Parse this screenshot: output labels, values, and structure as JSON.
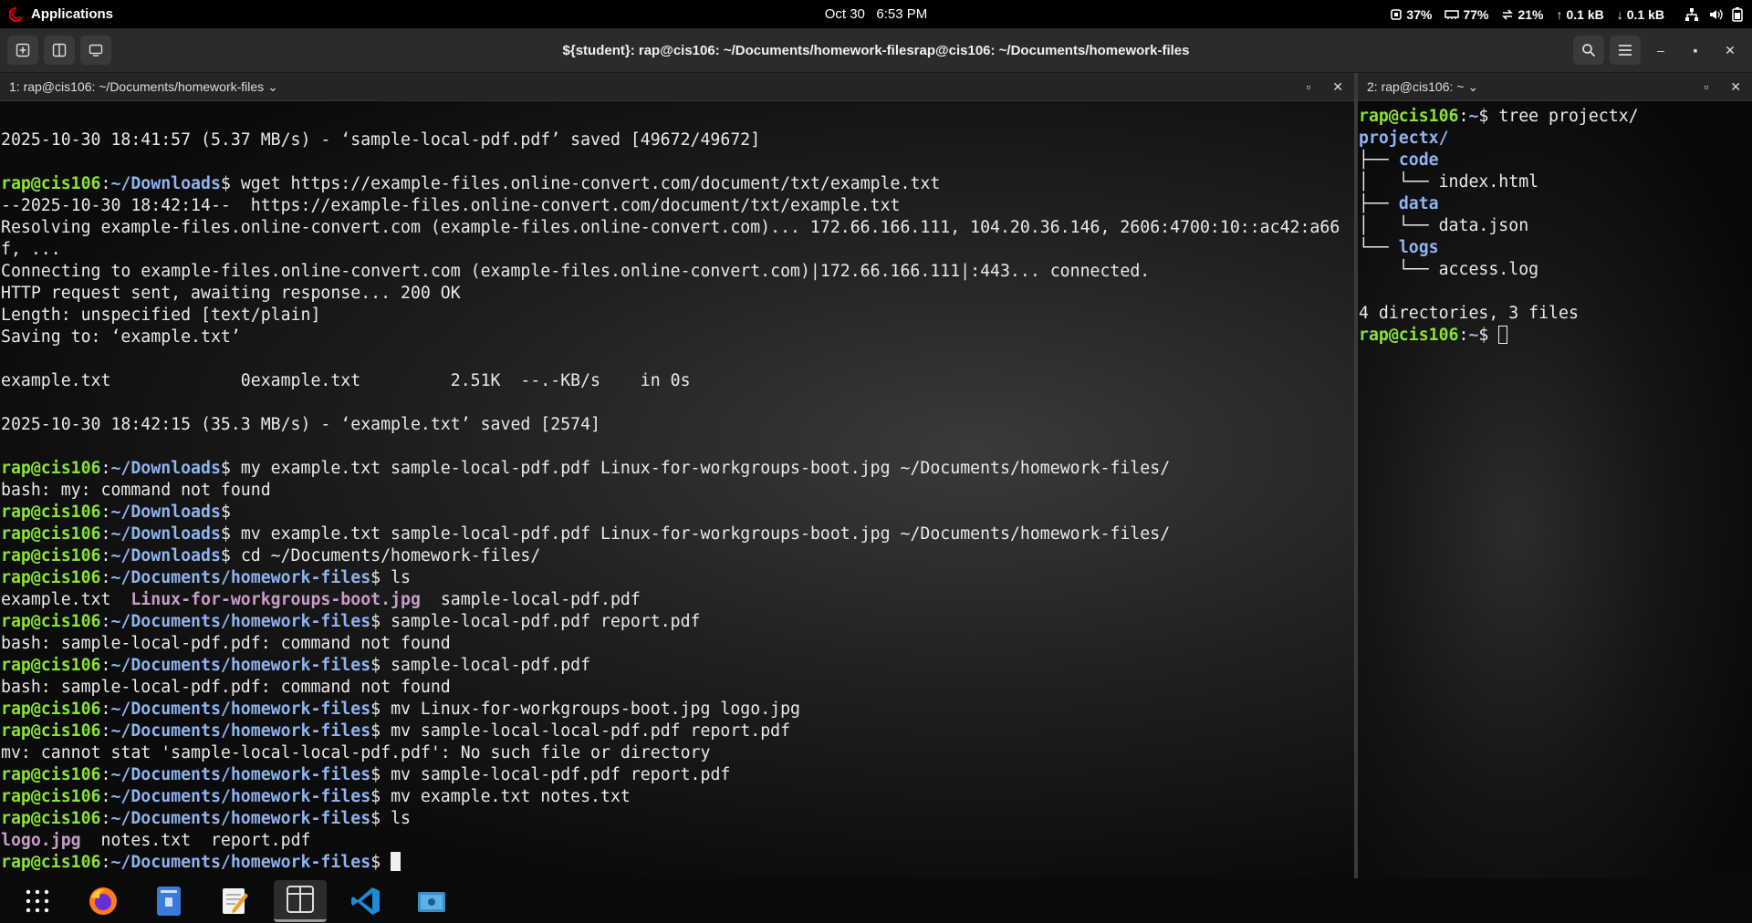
{
  "topbar": {
    "apps_label": "Applications",
    "date": "Oct 30",
    "time": "6:53 PM",
    "cpu": "37%",
    "mem": "77%",
    "swap": "21%",
    "net_up": "0.1 kB",
    "net_down": "0.1 kB"
  },
  "window": {
    "title": "${student}: rap@cis106: ~/Documents/homework-filesrap@cis106: ~/Documents/homework-files"
  },
  "pane_left": {
    "tab_label": "1: rap@cis106: ~/Documents/homework-files",
    "lines": [
      "",
      "2025-10-30 18:41:57 (5.37 MB/s) - ‘sample-local-pdf.pdf’ saved [49672/49672]",
      "",
      {
        "user": "rap@cis106",
        "path": "~/Downloads",
        "cmd": "wget https://example-files.online-convert.com/document/txt/example.txt"
      },
      "--2025-10-30 18:42:14--  https://example-files.online-convert.com/document/txt/example.txt",
      "Resolving example-files.online-convert.com (example-files.online-convert.com)... 172.66.166.111, 104.20.36.146, 2606:4700:10::ac42:a66",
      "f, ...",
      "Connecting to example-files.online-convert.com (example-files.online-convert.com)|172.66.166.111|:443... connected.",
      "HTTP request sent, awaiting response... 200 OK",
      "Length: unspecified [text/plain]",
      "Saving to: ‘example.txt’",
      "",
      "example.txt             0example.txt         2.51K  --.-KB/s    in 0s",
      "",
      "2025-10-30 18:42:15 (35.3 MB/s) - ‘example.txt’ saved [2574]",
      "",
      {
        "user": "rap@cis106",
        "path": "~/Downloads",
        "cmd": "my example.txt sample-local-pdf.pdf Linux-for-workgroups-boot.jpg ~/Documents/homework-files/"
      },
      "bash: my: command not found",
      {
        "user": "rap@cis106",
        "path": "~/Downloads",
        "cmd": ""
      },
      {
        "user": "rap@cis106",
        "path": "~/Downloads",
        "cmd": "mv example.txt sample-local-pdf.pdf Linux-for-workgroups-boot.jpg ~/Documents/homework-files/"
      },
      {
        "user": "rap@cis106",
        "path": "~/Downloads",
        "cmd": "cd ~/Documents/homework-files/"
      },
      {
        "user": "rap@cis106",
        "path": "~/Documents/homework-files",
        "cmd": "ls"
      },
      {
        "ls": [
          {
            "t": "example.txt",
            "c": ""
          },
          {
            "t": "Linux-for-workgroups-boot.jpg",
            "c": "m"
          },
          {
            "t": "sample-local-pdf.pdf",
            "c": ""
          }
        ]
      },
      {
        "user": "rap@cis106",
        "path": "~/Documents/homework-files",
        "cmd": "sample-local-pdf.pdf report.pdf"
      },
      "bash: sample-local-pdf.pdf: command not found",
      {
        "user": "rap@cis106",
        "path": "~/Documents/homework-files",
        "cmd": "sample-local-pdf.pdf"
      },
      "bash: sample-local-pdf.pdf: command not found",
      {
        "user": "rap@cis106",
        "path": "~/Documents/homework-files",
        "cmd": "mv Linux-for-workgroups-boot.jpg logo.jpg"
      },
      {
        "user": "rap@cis106",
        "path": "~/Documents/homework-files",
        "cmd": "mv sample-local-local-pdf.pdf report.pdf"
      },
      "mv: cannot stat 'sample-local-local-pdf.pdf': No such file or directory",
      {
        "user": "rap@cis106",
        "path": "~/Documents/homework-files",
        "cmd": "mv sample-local-pdf.pdf report.pdf"
      },
      {
        "user": "rap@cis106",
        "path": "~/Documents/homework-files",
        "cmd": "mv example.txt notes.txt"
      },
      {
        "user": "rap@cis106",
        "path": "~/Documents/homework-files",
        "cmd": "ls"
      },
      {
        "ls": [
          {
            "t": "logo.jpg",
            "c": "m"
          },
          {
            "t": "notes.txt",
            "c": ""
          },
          {
            "t": "report.pdf",
            "c": ""
          }
        ]
      },
      {
        "user": "rap@cis106",
        "path": "~/Documents/homework-files",
        "cmd": "",
        "cursor": "solid"
      }
    ]
  },
  "pane_right": {
    "tab_label": "2: rap@cis106: ~",
    "lines": [
      {
        "user": "rap@cis106",
        "path": "~",
        "cmd": "tree projectx/"
      },
      {
        "segs": [
          {
            "t": "projectx/",
            "c": "b"
          }
        ]
      },
      {
        "segs": [
          {
            "t": "├── ",
            "c": ""
          },
          {
            "t": "code",
            "c": "b"
          }
        ]
      },
      {
        "segs": [
          {
            "t": "│   └── index.html",
            "c": ""
          }
        ]
      },
      {
        "segs": [
          {
            "t": "├── ",
            "c": ""
          },
          {
            "t": "data",
            "c": "b"
          }
        ]
      },
      {
        "segs": [
          {
            "t": "│   └── data.json",
            "c": ""
          }
        ]
      },
      {
        "segs": [
          {
            "t": "└── ",
            "c": ""
          },
          {
            "t": "logs",
            "c": "b"
          }
        ]
      },
      {
        "segs": [
          {
            "t": "    └── access.log",
            "c": ""
          }
        ]
      },
      "",
      "4 directories, 3 files",
      {
        "user": "rap@cis106",
        "path": "~",
        "cmd": "",
        "cursor": "hollow"
      }
    ]
  },
  "dock": {
    "items": [
      {
        "name": "app-grid-icon",
        "active": false
      },
      {
        "name": "firefox-icon",
        "active": false
      },
      {
        "name": "file-manager-icon",
        "active": false
      },
      {
        "name": "text-editor-icon",
        "active": false
      },
      {
        "name": "terminal-icon",
        "active": true
      },
      {
        "name": "vscode-icon",
        "active": false
      },
      {
        "name": "screenshot-icon",
        "active": false
      }
    ]
  },
  "colors": {
    "prompt_user": "#8ae234",
    "prompt_path": "#8fb4f0",
    "image_file": "#c89dc8",
    "directory": "#8fb4f0"
  }
}
